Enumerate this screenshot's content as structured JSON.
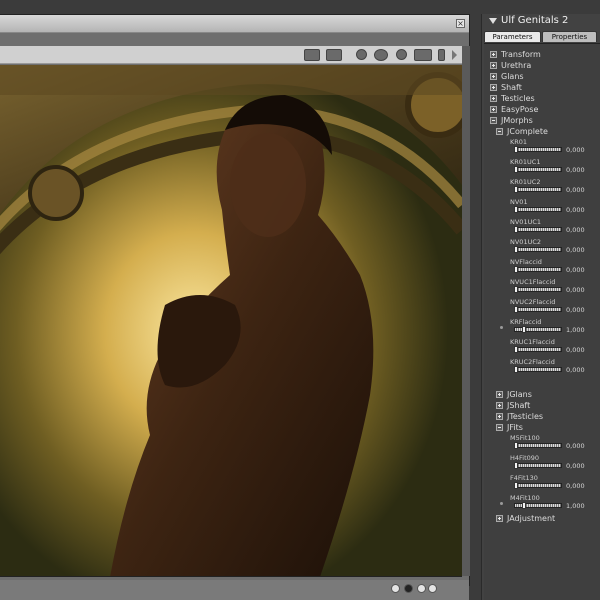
{
  "panel": {
    "title": "Ulf Genitals 2",
    "tabs": [
      {
        "label": "Parameters",
        "active": true
      },
      {
        "label": "Properties",
        "active": false
      }
    ],
    "groups_top": [
      {
        "label": "Transform",
        "expanded": false
      },
      {
        "label": "Urethra",
        "expanded": false
      },
      {
        "label": "Glans",
        "expanded": false
      },
      {
        "label": "Shaft",
        "expanded": false
      },
      {
        "label": "Testicles",
        "expanded": false
      },
      {
        "label": "EasyPose",
        "expanded": false
      },
      {
        "label": "JMorphs",
        "expanded": true
      }
    ],
    "jcomplete": {
      "label": "JComplete",
      "expanded": true,
      "params": [
        {
          "label": "KR01",
          "value": "0,000",
          "level": 0.0
        },
        {
          "label": "KR01UC1",
          "value": "0,000",
          "level": 0.0
        },
        {
          "label": "KR01UC2",
          "value": "0,000",
          "level": 0.0
        },
        {
          "label": "NV01",
          "value": "0,000",
          "level": 0.0
        },
        {
          "label": "NV01UC1",
          "value": "0,000",
          "level": 0.0
        },
        {
          "label": "NV01UC2",
          "value": "0,000",
          "level": 0.0
        },
        {
          "label": "NVFlaccid",
          "value": "0,000",
          "level": 0.0
        },
        {
          "label": "NVUC1Flaccid",
          "value": "0,000",
          "level": 0.0
        },
        {
          "label": "NVUC2Flaccid",
          "value": "0,000",
          "level": 0.0
        },
        {
          "label": "KRFlaccid",
          "value": "1,000",
          "level": 1.0
        },
        {
          "label": "KRUC1Flaccid",
          "value": "0,000",
          "level": 0.0
        },
        {
          "label": "KRUC2Flaccid",
          "value": "0,000",
          "level": 0.0
        }
      ]
    },
    "groups_mid": [
      {
        "label": "JGlans",
        "expanded": false
      },
      {
        "label": "JShaft",
        "expanded": false
      },
      {
        "label": "JTesticles",
        "expanded": false
      },
      {
        "label": "JFits",
        "expanded": true
      }
    ],
    "jfits_params": [
      {
        "label": "M5Fit100",
        "value": "0,000",
        "level": 0.0
      },
      {
        "label": "H4Fit090",
        "value": "0,000",
        "level": 0.0
      },
      {
        "label": "F4Fit130",
        "value": "0,000",
        "level": 0.0
      },
      {
        "label": "M4Fit100",
        "value": "1,000",
        "level": 1.0
      }
    ],
    "groups_bottom": [
      {
        "label": "JAdjustment",
        "expanded": false
      }
    ]
  },
  "viewport": {
    "toolbar_icons": [
      "camera-icon",
      "camera-alt-icon",
      "render-icon",
      "eye-icon",
      "sphere-icon",
      "move-icon",
      "light-icon"
    ],
    "page_dots": [
      {
        "active": false
      },
      {
        "active": true
      },
      {
        "active": false
      },
      {
        "active": false
      }
    ],
    "colors": {
      "glow": "#f2d57a",
      "bronze": "#8a6a2a",
      "skin": "#4a2c18",
      "dark": "#1e1a0c"
    }
  }
}
